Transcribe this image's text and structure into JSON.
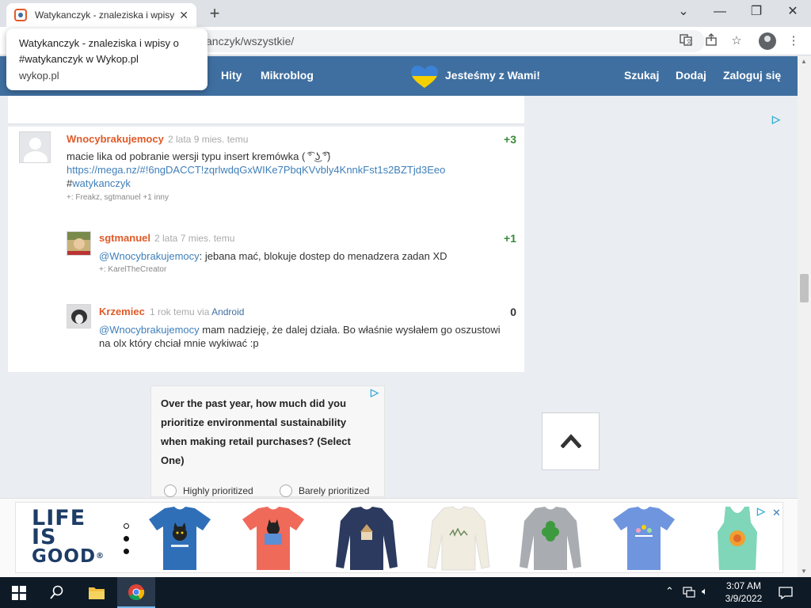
{
  "browser": {
    "tab_title": "Watykanczyk - znaleziska i wpisy",
    "tab_close": "✕",
    "new_tab": "+",
    "window_controls": {
      "minimize": "—",
      "maximize": "❐",
      "close": "✕",
      "tab_menu": "⌄"
    },
    "url": "anczyk/wszystkie/",
    "tooltip": {
      "line1": "Watykanczyk - znaleziska i wpisy o",
      "line2": "#watykanczyk w Wykop.pl",
      "domain": "wykop.pl"
    }
  },
  "site_nav": {
    "items": [
      "Hity",
      "Mikroblog"
    ],
    "peace_text": "Jesteśmy z Wami!",
    "right_items": [
      "Szukaj",
      "Dodaj",
      "Zaloguj się"
    ],
    "heart_colors": {
      "top": "#3b82d6",
      "bottom": "#f5d000"
    }
  },
  "comments": [
    {
      "author": "Wnocybrakujemocy",
      "time": "2 lata 9 mies. temu",
      "score": "+3",
      "text": "macie lika od pobranie wersji typu insert kremówka ( ͡° ͜ʖ ͡°)",
      "link": "https://mega.nz/#!6ngDACCT!zqrlwdqGxWIKe7PbqKVvbly4KnnkFst1s2BZTjd3Eeo",
      "tag_hash": "#",
      "tag": "watykanczyk",
      "plus": "+: Freakz, sgtmanuel +1 inny"
    },
    {
      "author": "sgtmanuel",
      "time": "2 lata 7 mies. temu",
      "score": "+1",
      "mention": "@Wnocybrakujemocy",
      "text": ": jebana mać, blokuje dostep do menadzera zadan XD",
      "plus": "+: KarelTheCreator"
    },
    {
      "author": "Krzemiec",
      "time": "1 rok temu",
      "via": "via",
      "via_app": "Android",
      "score": "0",
      "mention": "@Wnocybrakujemocy",
      "text": " mam nadzieję, że dalej działa. Bo właśnie wysłałem go oszustowi",
      "text2": "na olx który chciał mnie wykiwać :p"
    }
  ],
  "survey_ad": {
    "question": "Over the past year, how much did you prioritize environmental sustainability when making retail purchases? (Select One)",
    "options": [
      "Highly prioritized",
      "Barely prioritized"
    ]
  },
  "banner_ad": {
    "brand_line1": "LIFE",
    "brand_line2": "IS",
    "brand_line3": "GOOD",
    "registered": "®",
    "close": "✕",
    "shirts": [
      {
        "name": "blue-cat-tee",
        "color": "#2f6fb8"
      },
      {
        "name": "coral-cat-book-tee",
        "color": "#f06a5a"
      },
      {
        "name": "navy-longsleeve",
        "color": "#2b3a5e"
      },
      {
        "name": "cream-longsleeve",
        "color": "#f1ece0"
      },
      {
        "name": "gray-clover-longsleeve",
        "color": "#a9acb0"
      },
      {
        "name": "periwinkle-tee",
        "color": "#6f95de"
      },
      {
        "name": "mint-tank",
        "color": "#7fd6b8"
      }
    ]
  },
  "taskbar": {
    "time": "3:07 AM",
    "date": "3/9/2022"
  }
}
